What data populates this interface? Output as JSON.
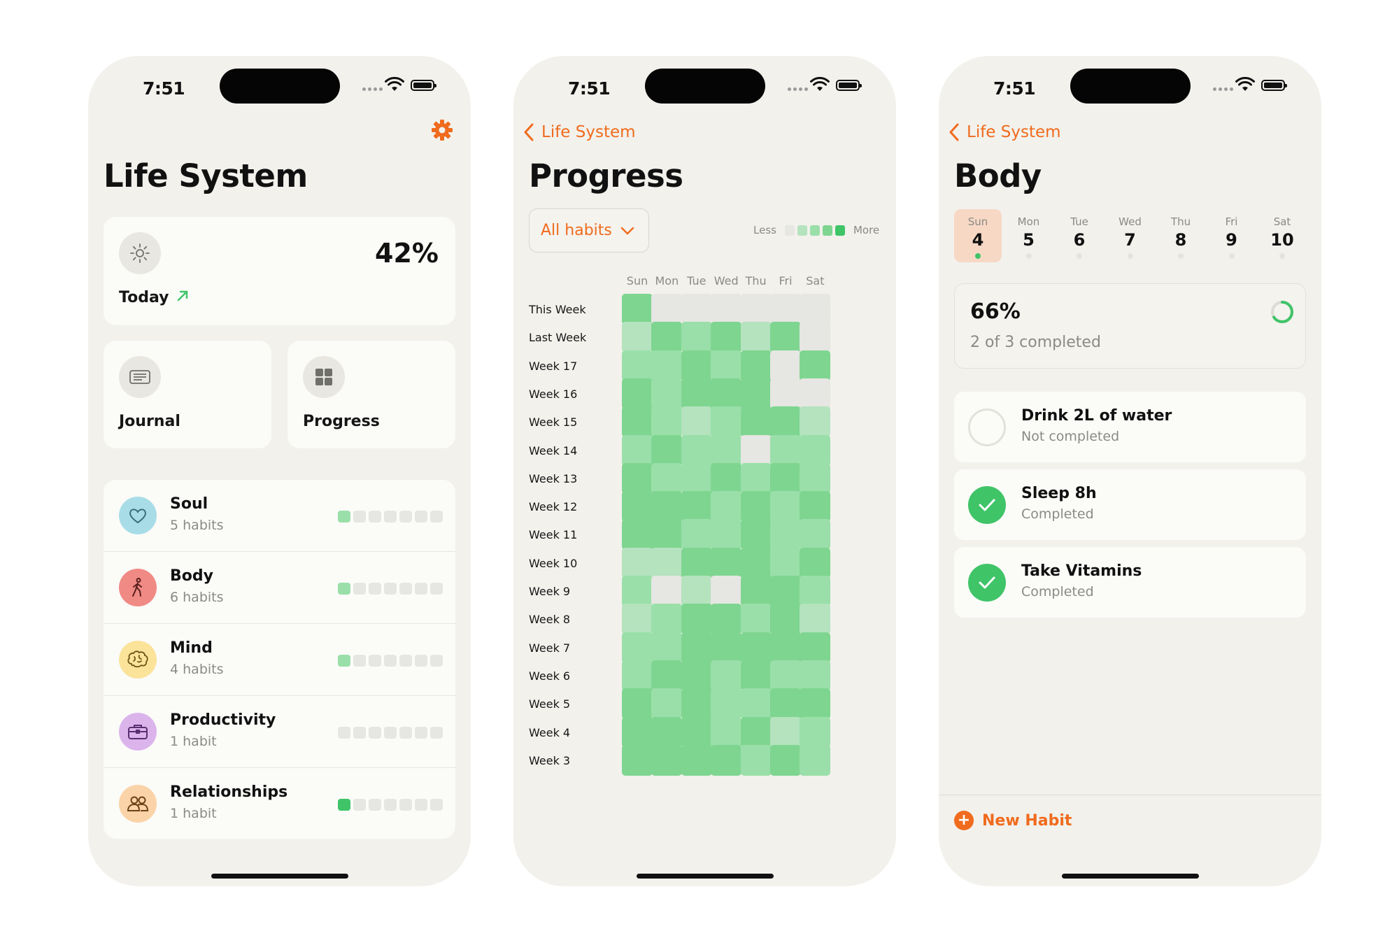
{
  "status_bar": {
    "time": "7:51"
  },
  "home": {
    "title": "Life System",
    "today": {
      "label": "Today",
      "percent": "42%"
    },
    "tiles": [
      {
        "label": "Journal"
      },
      {
        "label": "Progress"
      }
    ],
    "categories": [
      {
        "name": "Soul",
        "count": "5 habits",
        "icon": "heart-icon",
        "color": "#a8dde8",
        "filled_days": 1
      },
      {
        "name": "Body",
        "count": "6 habits",
        "icon": "walking-person-icon",
        "color": "#f08a85",
        "filled_days": 1
      },
      {
        "name": "Mind",
        "count": "4 habits",
        "icon": "brain-icon",
        "color": "#fbe39a",
        "filled_days": 1
      },
      {
        "name": "Productivity",
        "count": "1 habit",
        "icon": "briefcase-icon",
        "color": "#dcb4ec",
        "filled_days": 0
      },
      {
        "name": "Relationships",
        "count": "1 habit",
        "icon": "people-icon",
        "color": "#fbd3a8",
        "filled_days": 1
      }
    ]
  },
  "progress": {
    "back_label": "Life System",
    "title": "Progress",
    "filter": "All habits",
    "legend": {
      "less": "Less",
      "more": "More"
    },
    "days": [
      "Sun",
      "Mon",
      "Tue",
      "Wed",
      "Thu",
      "Fri",
      "Sat"
    ],
    "weeks": [
      {
        "label": "This Week",
        "levels": [
          3,
          0,
          0,
          0,
          0,
          0,
          0
        ]
      },
      {
        "label": "Last Week",
        "levels": [
          1,
          3,
          2,
          3,
          1,
          3,
          0
        ]
      },
      {
        "label": "Week 17",
        "levels": [
          2,
          2,
          3,
          2,
          3,
          0,
          3
        ]
      },
      {
        "label": "Week 16",
        "levels": [
          3,
          2,
          3,
          3,
          3,
          0,
          0
        ]
      },
      {
        "label": "Week 15",
        "levels": [
          3,
          2,
          1,
          2,
          3,
          3,
          1
        ]
      },
      {
        "label": "Week 14",
        "levels": [
          2,
          3,
          2,
          2,
          0,
          2,
          2
        ]
      },
      {
        "label": "Week 13",
        "levels": [
          3,
          2,
          2,
          3,
          2,
          3,
          2
        ]
      },
      {
        "label": "Week 12",
        "levels": [
          3,
          3,
          3,
          2,
          3,
          2,
          3
        ]
      },
      {
        "label": "Week 11",
        "levels": [
          3,
          3,
          2,
          2,
          3,
          2,
          2
        ]
      },
      {
        "label": "Week 10",
        "levels": [
          1,
          1,
          3,
          3,
          3,
          2,
          3
        ]
      },
      {
        "label": "Week 9",
        "levels": [
          2,
          0,
          1,
          0,
          3,
          3,
          2
        ]
      },
      {
        "label": "Week 8",
        "levels": [
          1,
          2,
          3,
          3,
          2,
          3,
          1
        ]
      },
      {
        "label": "Week 7",
        "levels": [
          2,
          2,
          3,
          3,
          3,
          3,
          3
        ]
      },
      {
        "label": "Week 6",
        "levels": [
          2,
          3,
          3,
          2,
          3,
          2,
          2
        ]
      },
      {
        "label": "Week 5",
        "levels": [
          3,
          2,
          3,
          2,
          2,
          3,
          3
        ]
      },
      {
        "label": "Week 4",
        "levels": [
          3,
          3,
          3,
          2,
          3,
          1,
          2
        ]
      },
      {
        "label": "Week 3",
        "levels": [
          3,
          3,
          3,
          3,
          2,
          3,
          2
        ]
      }
    ],
    "level_colors": [
      "#e6e6e2",
      "#b4e3be",
      "#9adfa9",
      "#7ed590"
    ]
  },
  "body": {
    "back_label": "Life System",
    "title": "Body",
    "week": [
      {
        "name": "Sun",
        "date": "4",
        "selected": true
      },
      {
        "name": "Mon",
        "date": "5"
      },
      {
        "name": "Tue",
        "date": "6"
      },
      {
        "name": "Wed",
        "date": "7"
      },
      {
        "name": "Thu",
        "date": "8"
      },
      {
        "name": "Fri",
        "date": "9"
      },
      {
        "name": "Sat",
        "date": "10"
      }
    ],
    "summary": {
      "percent": "66%",
      "text": "2 of 3 completed",
      "progress": 0.66
    },
    "habits": [
      {
        "name": "Drink 2L of water",
        "status": "Not completed",
        "done": false
      },
      {
        "name": "Sleep 8h",
        "status": "Completed",
        "done": true
      },
      {
        "name": "Take Vitamins",
        "status": "Completed",
        "done": true
      }
    ],
    "new_habit": "New Habit"
  },
  "colors": {
    "accent": "#f06b1d",
    "success": "#3fc468",
    "background": "#f2f1ec",
    "card": "#fbfbf8"
  }
}
